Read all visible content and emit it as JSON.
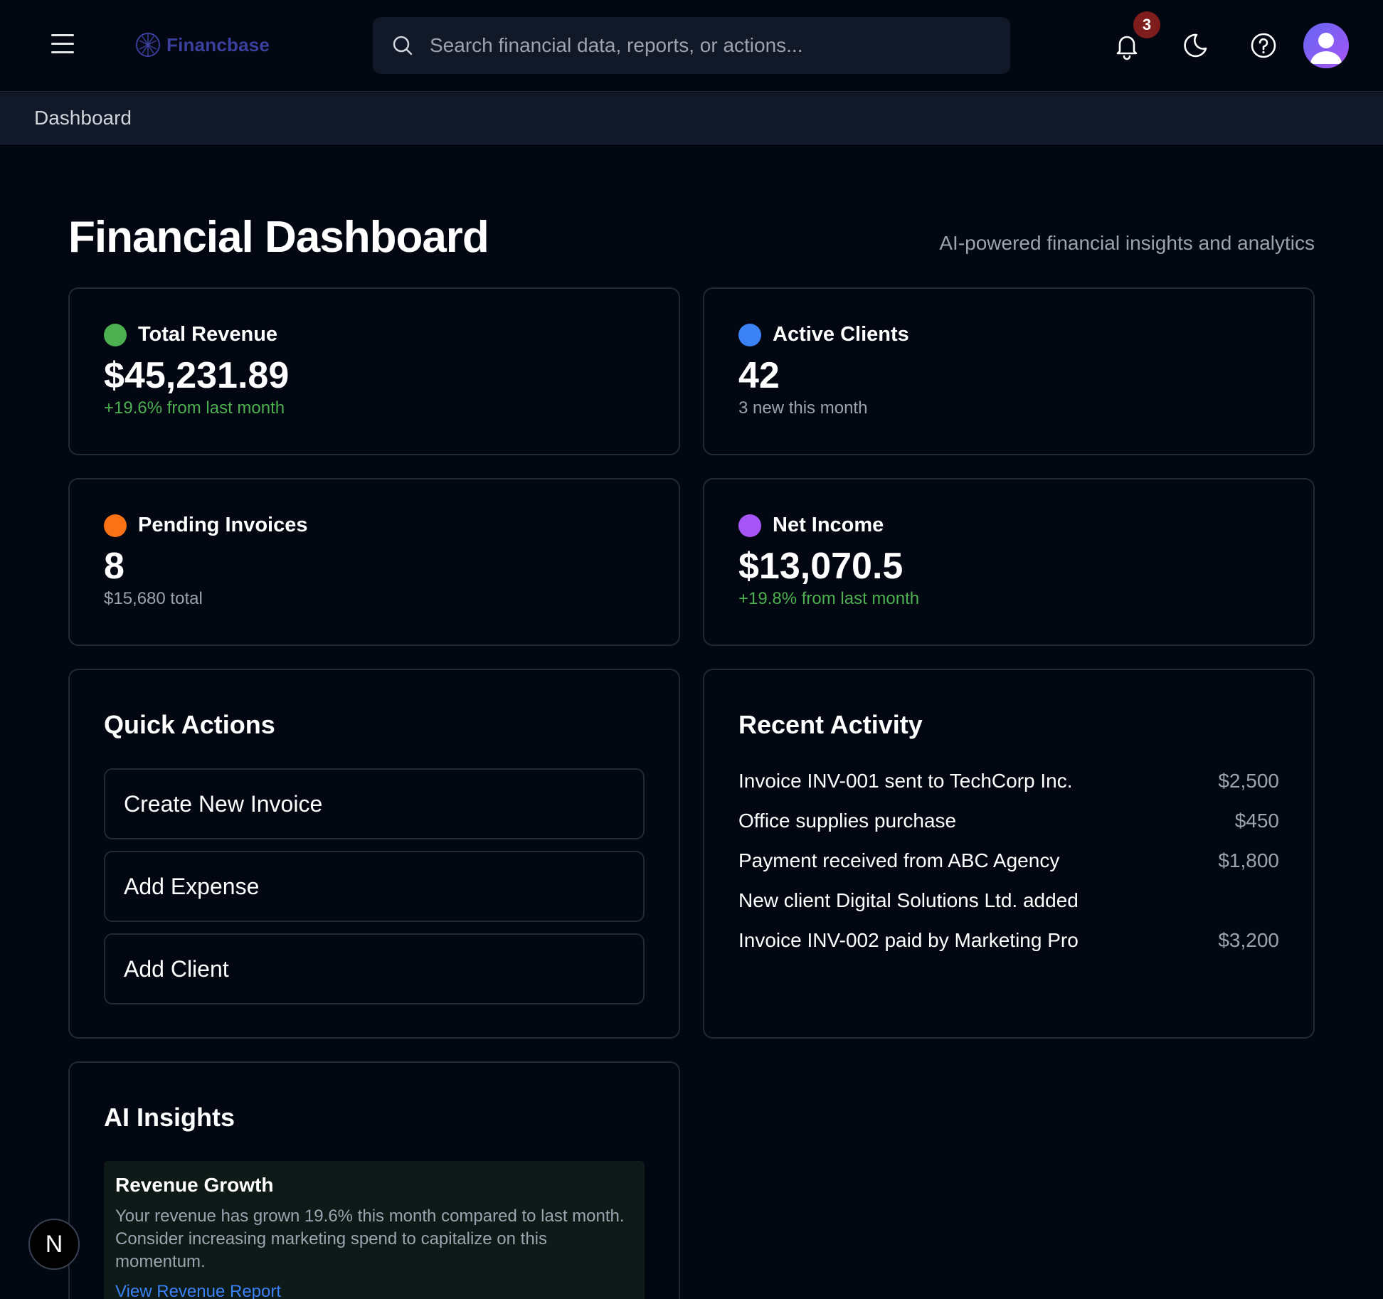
{
  "header": {
    "brand": "Financbase",
    "search": {
      "placeholder": "Search financial data, reports, or actions..."
    },
    "notifications_count": "3",
    "icons": [
      "menu-icon",
      "logo-icon",
      "search-icon",
      "bell-icon",
      "moon-icon",
      "help-icon",
      "user-icon"
    ]
  },
  "breadcrumb": "Dashboard",
  "page": {
    "title": "Financial Dashboard",
    "subtitle": "AI-powered financial insights and analytics"
  },
  "stats": [
    {
      "label": "Total Revenue",
      "value": "$45,231.89",
      "note": "+19.6% from last month",
      "color": "#4caf50"
    },
    {
      "label": "Active Clients",
      "value": "42",
      "note": "3 new this month",
      "color": "#3b82f6"
    },
    {
      "label": "Pending Invoices",
      "value": "8",
      "note": "$15,680 total",
      "color": "#f97316"
    },
    {
      "label": "Net Income",
      "value": "$13,070.5",
      "note": "+19.8% from last month",
      "color": "#a855f7"
    }
  ],
  "quick_actions": {
    "title": "Quick Actions",
    "items": [
      "Create New Invoice",
      "Add Expense",
      "Add Client"
    ]
  },
  "recent_activity": {
    "title": "Recent Activity",
    "items": [
      {
        "text": "Invoice INV-001 sent to TechCorp Inc.",
        "amount": "$2,500"
      },
      {
        "text": "Office supplies purchase",
        "amount": "$450"
      },
      {
        "text": "Payment received from ABC Agency",
        "amount": "$1,800"
      },
      {
        "text": "New client Digital Solutions Ltd. added",
        "amount": ""
      },
      {
        "text": "Invoice INV-002 paid by Marketing Pro",
        "amount": "$3,200"
      }
    ]
  },
  "ai_insights": {
    "title": "AI Insights",
    "card": {
      "title": "Revenue Growth",
      "body": "Your revenue has grown 19.6% this month compared to last month. Consider increasing marketing spend to capitalize on this momentum.",
      "link": "View Revenue Report"
    }
  },
  "dev_badge": "N",
  "colors": {
    "background": "#030712",
    "card_border": "#1f2937",
    "accent_link": "#3b82f6",
    "badge": "#7f1d1d"
  }
}
